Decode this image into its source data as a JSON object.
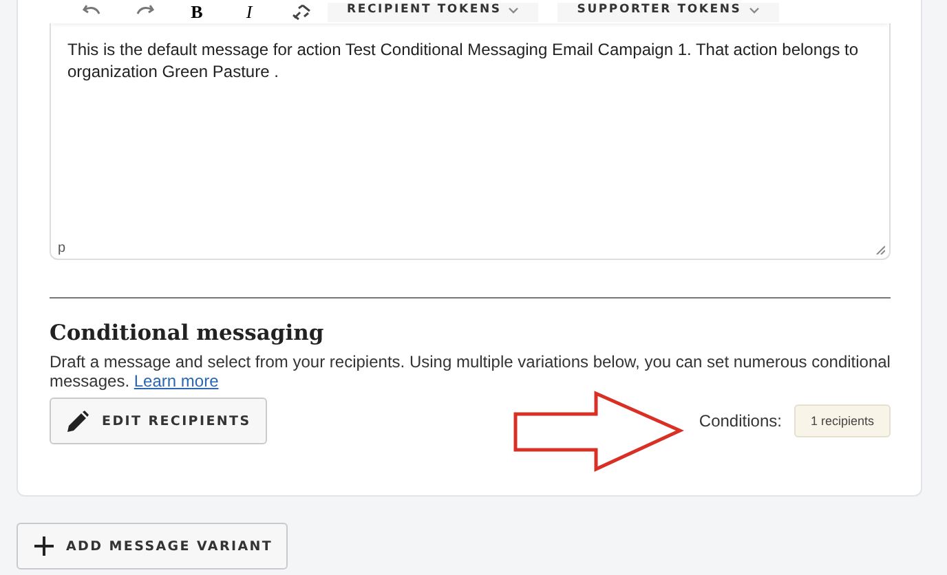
{
  "toolbar": {
    "format_buttons": [
      {
        "label": "B"
      },
      {
        "label": "I"
      }
    ],
    "dropdowns": [
      {
        "label": "RECIPIENT TOKENS"
      },
      {
        "label": "SUPPORTER TOKENS"
      }
    ]
  },
  "editor": {
    "body": "This is the default message for action Test Conditional Messaging Email Campaign 1. That action belongs to organization Green Pasture .",
    "element_path": "p"
  },
  "conditional": {
    "heading": "Conditional messaging",
    "description": "Draft a message and select from your recipients. Using multiple variations below, you can set numerous conditional messages.",
    "link": "Learn more",
    "edit_button": "EDIT RECIPIENTS",
    "conditions_label": "Conditions:",
    "conditions_badge": "1 recipients"
  },
  "add_button": "ADD MESSAGE VARIANT"
}
